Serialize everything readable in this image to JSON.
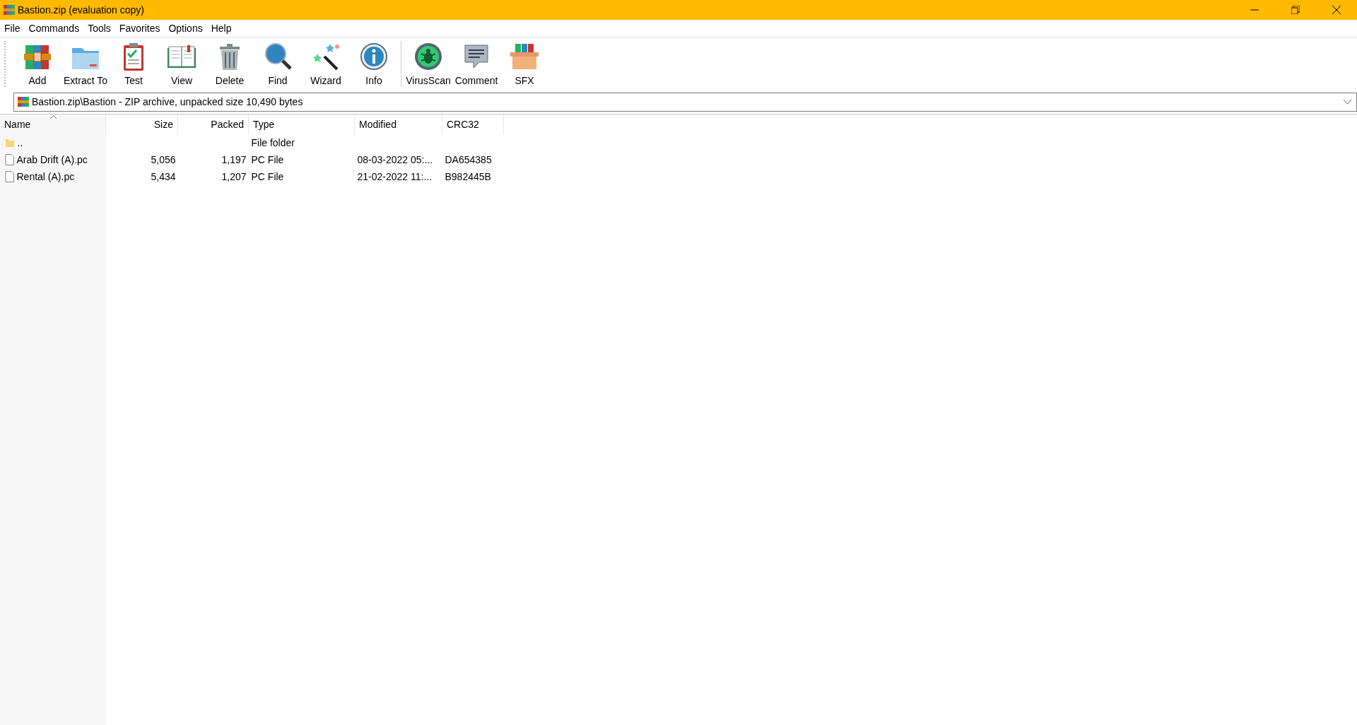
{
  "window": {
    "title": "Bastion.zip (evaluation copy)"
  },
  "menu": [
    "File",
    "Commands",
    "Tools",
    "Favorites",
    "Options",
    "Help"
  ],
  "toolbar": {
    "groups": [
      [
        {
          "label": "Add",
          "kind": "add"
        },
        {
          "label": "Extract To",
          "kind": "extract"
        },
        {
          "label": "Test",
          "kind": "test"
        },
        {
          "label": "View",
          "kind": "view"
        },
        {
          "label": "Delete",
          "kind": "delete"
        },
        {
          "label": "Find",
          "kind": "find"
        },
        {
          "label": "Wizard",
          "kind": "wizard"
        },
        {
          "label": "Info",
          "kind": "info"
        }
      ],
      [
        {
          "label": "VirusScan",
          "kind": "virus"
        },
        {
          "label": "Comment",
          "kind": "comment"
        },
        {
          "label": "SFX",
          "kind": "sfx"
        }
      ]
    ]
  },
  "address": {
    "value": "Bastion.zip\\Bastion - ZIP archive, unpacked size 10,490 bytes"
  },
  "table": {
    "columns": [
      {
        "label": "Name",
        "sorted": true
      },
      {
        "label": "Size",
        "sorted": false
      },
      {
        "label": "Packed",
        "sorted": false
      },
      {
        "label": "Type",
        "sorted": false
      },
      {
        "label": "Modified",
        "sorted": false
      },
      {
        "label": "CRC32",
        "sorted": false
      }
    ],
    "rows": [
      {
        "kind": "folder",
        "cells": [
          "..",
          "",
          "",
          "File folder",
          "",
          ""
        ]
      },
      {
        "kind": "file",
        "cells": [
          "Arab Drift (A).pc",
          "5,056",
          "1,197",
          "PC File",
          "08-03-2022 05:...",
          "DA654385"
        ]
      },
      {
        "kind": "file",
        "cells": [
          "Rental (A).pc",
          "5,434",
          "1,207",
          "PC File",
          "21-02-2022 11:...",
          "B982445B"
        ]
      }
    ]
  }
}
